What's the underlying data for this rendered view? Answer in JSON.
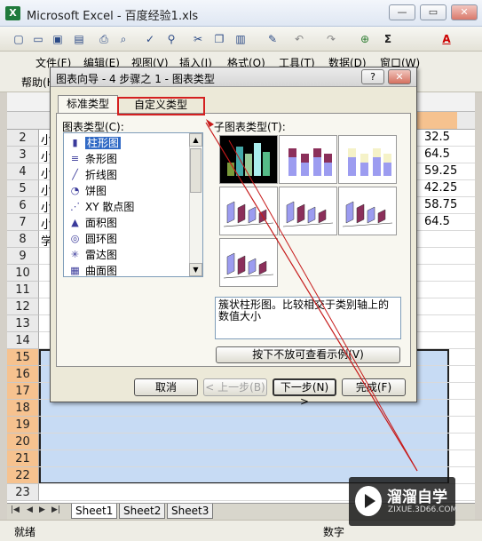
{
  "window": {
    "title": "Microsoft Excel - 百度经验1.xls",
    "minimize": "—",
    "restore": "▭",
    "close": "✕"
  },
  "menu": {
    "items": [
      "文件(F)",
      "编辑(E)",
      "视图(V)",
      "插入(I)",
      "格式(O)",
      "工具(T)",
      "数据(D)",
      "窗口(W)"
    ],
    "help": "帮助(H)"
  },
  "sheet": {
    "rows": [
      "2",
      "3",
      "4",
      "5",
      "6",
      "7",
      "8",
      "9",
      "10",
      "11",
      "12",
      "13",
      "14",
      "15",
      "16",
      "17",
      "18",
      "19",
      "20",
      "21",
      "22",
      "23"
    ],
    "colA_text": [
      "小",
      "小",
      "小",
      "小",
      "小",
      "小",
      "学"
    ],
    "right_values": [
      "32.5",
      "64.5",
      "59.25",
      "42.25",
      "58.75",
      "64.5"
    ],
    "tabs": [
      "Sheet1",
      "Sheet2",
      "Sheet3"
    ],
    "status_left": "就绪",
    "status_right": "数字"
  },
  "dialog": {
    "title": "图表向导 - 4 步骤之 1 - 图表类型",
    "help_btn": "?",
    "close_btn": "✕",
    "tab_standard": "标准类型",
    "tab_custom": "自定义类型",
    "label_chart_type": "图表类型(C):",
    "label_sub_type": "子图表类型(T):",
    "chart_types": [
      {
        "label": "柱形图",
        "icon": "bar-chart-icon",
        "glyph": "▮"
      },
      {
        "label": "条形图",
        "icon": "horizontal-bar-icon",
        "glyph": "≡"
      },
      {
        "label": "折线图",
        "icon": "line-chart-icon",
        "glyph": "╱"
      },
      {
        "label": "饼图",
        "icon": "pie-chart-icon",
        "glyph": "◔"
      },
      {
        "label": "XY 散点图",
        "icon": "scatter-icon",
        "glyph": "⋰"
      },
      {
        "label": "面积图",
        "icon": "area-chart-icon",
        "glyph": "▲"
      },
      {
        "label": "圆环图",
        "icon": "donut-chart-icon",
        "glyph": "◎"
      },
      {
        "label": "雷达图",
        "icon": "radar-chart-icon",
        "glyph": "✳"
      },
      {
        "label": "曲面图",
        "icon": "surface-chart-icon",
        "glyph": "▦"
      }
    ],
    "description": "簇状柱形图。比较相交于类别轴上的数值大小",
    "preview_btn": "按下不放可查看示例(V)",
    "buttons": {
      "cancel": "取消",
      "back": "< 上一步(B)",
      "next": "下一步(N) >",
      "finish": "完成(F)"
    },
    "colors": {
      "bar_purple": "#8b2f5a",
      "bar_lav": "#9c9cf0",
      "bar_cream": "#f5f2c8",
      "highlight_red": "#d42020"
    }
  },
  "watermark": {
    "brand": "溜溜自学",
    "url": "ZIXUE.3D66.COM"
  }
}
